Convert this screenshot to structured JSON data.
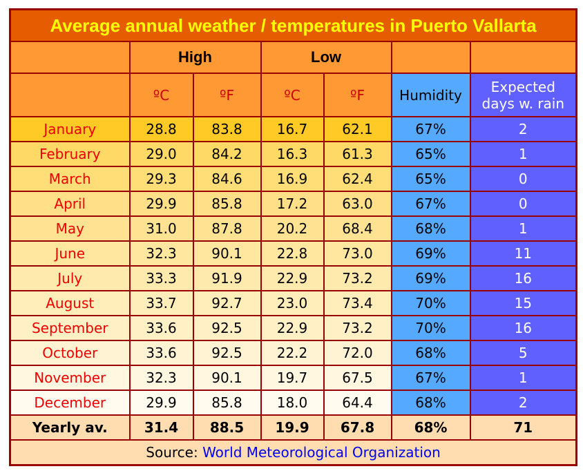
{
  "title": "Average annual weather / temperatures in Puerto Vallarta",
  "headers": {
    "high": "High",
    "low": "Low",
    "celsius": "ºC",
    "fahrenheit": "ºF",
    "humidity": "Humidity",
    "rain_line1": "Expected",
    "rain_line2": "days w. rain"
  },
  "rows": [
    {
      "month": "January",
      "high_c": "28.8",
      "high_f": "83.8",
      "low_c": "16.7",
      "low_f": "62.1",
      "humidity": "67%",
      "rain": "2"
    },
    {
      "month": "February",
      "high_c": "29.0",
      "high_f": "84.2",
      "low_c": "16.3",
      "low_f": "61.3",
      "humidity": "65%",
      "rain": "1"
    },
    {
      "month": "March",
      "high_c": "29.3",
      "high_f": "84.6",
      "low_c": "16.9",
      "low_f": "62.4",
      "humidity": "65%",
      "rain": "0"
    },
    {
      "month": "April",
      "high_c": "29.9",
      "high_f": "85.8",
      "low_c": "17.2",
      "low_f": "63.0",
      "humidity": "67%",
      "rain": "0"
    },
    {
      "month": "May",
      "high_c": "31.0",
      "high_f": "87.8",
      "low_c": "20.2",
      "low_f": "68.4",
      "humidity": "68%",
      "rain": "1"
    },
    {
      "month": "June",
      "high_c": "32.3",
      "high_f": "90.1",
      "low_c": "22.8",
      "low_f": "73.0",
      "humidity": "69%",
      "rain": "11"
    },
    {
      "month": "July",
      "high_c": "33.3",
      "high_f": "91.9",
      "low_c": "22.9",
      "low_f": "73.2",
      "humidity": "69%",
      "rain": "16"
    },
    {
      "month": "August",
      "high_c": "33.7",
      "high_f": "92.7",
      "low_c": "23.0",
      "low_f": "73.4",
      "humidity": "70%",
      "rain": "15"
    },
    {
      "month": "September",
      "high_c": "33.6",
      "high_f": "92.5",
      "low_c": "22.9",
      "low_f": "73.2",
      "humidity": "70%",
      "rain": "16"
    },
    {
      "month": "October",
      "high_c": "33.6",
      "high_f": "92.5",
      "low_c": "22.2",
      "low_f": "72.0",
      "humidity": "68%",
      "rain": "5"
    },
    {
      "month": "November",
      "high_c": "32.3",
      "high_f": "90.1",
      "low_c": "19.7",
      "low_f": "67.5",
      "humidity": "67%",
      "rain": "1"
    },
    {
      "month": "December",
      "high_c": "29.9",
      "high_f": "85.8",
      "low_c": "18.0",
      "low_f": "64.4",
      "humidity": "68%",
      "rain": "2"
    }
  ],
  "row_colors": [
    "#FFC926",
    "#FFD966",
    "#FFDD77",
    "#FFE088",
    "#FFE393",
    "#FFE7A0",
    "#FFEAAE",
    "#FFEDBA",
    "#FFF0C6",
    "#FFF3D3",
    "#FFF7E0",
    "#FFFBEE"
  ],
  "yearly": {
    "label": "Yearly av.",
    "high_c": "31.4",
    "high_f": "88.5",
    "low_c": "19.9",
    "low_f": "67.8",
    "humidity": "68%",
    "rain": "71"
  },
  "source": {
    "label": "Source:",
    "link": "World Meteorological Organization"
  },
  "colors": {
    "title_bg": "#E65C00",
    "title_text": "#FFFF00",
    "header_bg": "#FF9933",
    "humidity_bg": "#55AAFF",
    "rain_bg": "#6060FF",
    "border": "#990000",
    "month_text": "#EE0000"
  }
}
